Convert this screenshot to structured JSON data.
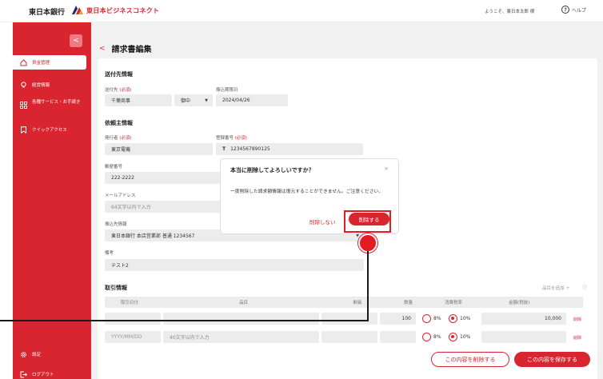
{
  "header": {
    "brand_primary": "東日本銀行",
    "brand_secondary": "東日本ビジネスコネクト",
    "welcome": "ようこそ、東日本太郎 様",
    "help": "ヘルプ",
    "help_glyph": "?"
  },
  "sidebar": {
    "collapse_glyph": "<",
    "items": [
      {
        "label": "資金管理",
        "icon": "home-icon"
      },
      {
        "label": "経営情報",
        "icon": "lightbulb-icon"
      },
      {
        "label": "各種サービス・お手続き",
        "icon": "grid-icon"
      },
      {
        "label": "クイックアクセス",
        "icon": "bookmark-icon"
      }
    ],
    "settings": "設定",
    "logout": "ログアウト"
  },
  "page": {
    "back_glyph": "<",
    "title": "請求書編集"
  },
  "recipient": {
    "title": "送付先情報",
    "to_label": "送付先",
    "required": "(必須)",
    "to_value": "千葉商事",
    "honorific": "御中",
    "due_label": "振込期限日",
    "due_value": "2024/04/26"
  },
  "requester": {
    "title": "依頼主情報",
    "issuer_label": "発行者",
    "issuer_value": "東京電機",
    "reg_label": "登録番号",
    "reg_prefix": "T",
    "reg_value": "1234567890125",
    "zip_label": "郵便番号",
    "zip_value": "222-2222",
    "email_label": "メールアドレス",
    "email_placeholder": "64文字以内で入力",
    "bank_label": "振込先情報",
    "bank_value": "東日本銀行 本店営業部 普通 1234567",
    "note_label": "備考",
    "note_value": "テスト2"
  },
  "transactions": {
    "title": "取引情報",
    "add_item": "品目を追加 ＋",
    "headers": [
      "取引日付",
      "品目",
      "単価",
      "数量",
      "消費税率",
      "金額(税抜)"
    ],
    "rows": [
      {
        "date": "",
        "item": "",
        "price": "",
        "qty": "100",
        "tax8": "8%",
        "tax10": "10%",
        "selected": "10%",
        "amount": "10,000",
        "delete": "削除"
      },
      {
        "date": "YYYY/MM/DD",
        "item": "40文字以内で入力",
        "price": "",
        "qty": "",
        "tax8": "8%",
        "tax10": "10%",
        "selected": "10%",
        "amount": "",
        "delete": "削除"
      }
    ]
  },
  "actions": {
    "delete_content": "この内容を削除する",
    "save_content": "この内容を保存する"
  },
  "dialog": {
    "title": "本当に削除してよろしいですか？",
    "close_glyph": "×",
    "message": "一度削除した請求額情報は復元することができません。ご注意ください。",
    "cancel": "削除しない",
    "confirm": "削除する"
  },
  "colors": {
    "brand_red": "#d9252f",
    "callout_red": "#e31b23"
  }
}
